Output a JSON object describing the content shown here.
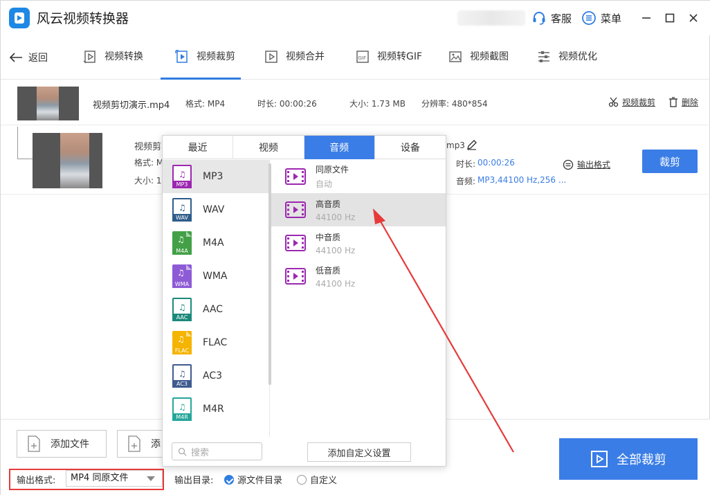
{
  "app": {
    "title": "风云视频转换器"
  },
  "titlebar": {
    "support_label": "客服",
    "menu_label": "菜单"
  },
  "nav": {
    "back_label": "返回",
    "tabs": [
      {
        "label": "视频转换"
      },
      {
        "label": "视频裁剪"
      },
      {
        "label": "视频合并"
      },
      {
        "label": "视频转GIF"
      },
      {
        "label": "视频截图"
      },
      {
        "label": "视频优化"
      }
    ]
  },
  "file1": {
    "name": "视频剪切演示.mp4",
    "format": "格式: MP4",
    "duration": "时长: 00:00:26",
    "size": "大小: 1.73 MB",
    "resolution": "分辨率: 480*854",
    "crop_link": "视频裁剪",
    "delete_link": "删除"
  },
  "file2": {
    "name_visible": "视频剪",
    "ext_visible": "mp3",
    "format_visible": "格式: M",
    "size_visible": "大小: 1",
    "duration_label": "时长:",
    "duration_value": "00:00:26",
    "audio_label": "音频:",
    "audio_value": "MP3,44100 Hz,256 ...",
    "output_format_link": "输出格式",
    "crop_button": "裁剪"
  },
  "popup": {
    "tabs": [
      {
        "label": "最近"
      },
      {
        "label": "视频"
      },
      {
        "label": "音频"
      },
      {
        "label": "设备"
      }
    ],
    "formats": [
      {
        "label": "MP3",
        "tag": "MP3",
        "color": "#9c27b0",
        "style": "outline"
      },
      {
        "label": "WAV",
        "tag": "WAV",
        "color": "#2e5c8a",
        "style": "outline"
      },
      {
        "label": "M4A",
        "tag": "M4A",
        "color": "#43a047",
        "style": "solid"
      },
      {
        "label": "WMA",
        "tag": "WMA",
        "color": "#8e5bd6",
        "style": "solid"
      },
      {
        "label": "AAC",
        "tag": "AAC",
        "color": "#1b8a7a",
        "style": "outline"
      },
      {
        "label": "FLAC",
        "tag": "FLAC",
        "color": "#f5b400",
        "style": "solid"
      },
      {
        "label": "AC3",
        "tag": "AC3",
        "color": "#3f5b8f",
        "style": "outline"
      },
      {
        "label": "M4R",
        "tag": "M4R",
        "color": "#26a69a",
        "style": "outline"
      }
    ],
    "qualities": [
      {
        "title": "同原文件",
        "sub": "自动"
      },
      {
        "title": "高音质",
        "sub": "44100 Hz"
      },
      {
        "title": "中音质",
        "sub": "44100 Hz"
      },
      {
        "title": "低音质",
        "sub": "44100 Hz"
      }
    ],
    "search_placeholder": "搜索",
    "custom_button": "添加自定义设置"
  },
  "bottom": {
    "add_file_label": "添加文件",
    "add_folder_visible": "添",
    "output_format_label": "输出格式:",
    "output_format_value": "MP4 同原文件",
    "output_dir_label": "输出目录:",
    "radio_source": "源文件目录",
    "radio_custom": "自定义",
    "all_crop_label": "全部裁剪"
  },
  "colors": {
    "accent": "#3a7de6",
    "annotation": "#e63a3a"
  }
}
